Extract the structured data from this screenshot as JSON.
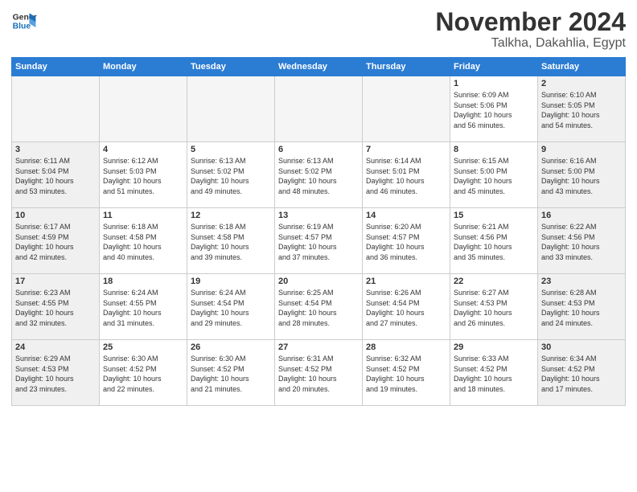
{
  "header": {
    "logo_line1": "General",
    "logo_line2": "Blue",
    "month": "November 2024",
    "location": "Talkha, Dakahlia, Egypt"
  },
  "weekdays": [
    "Sunday",
    "Monday",
    "Tuesday",
    "Wednesday",
    "Thursday",
    "Friday",
    "Saturday"
  ],
  "weeks": [
    [
      {
        "num": "",
        "info": "",
        "type": "empty"
      },
      {
        "num": "",
        "info": "",
        "type": "empty"
      },
      {
        "num": "",
        "info": "",
        "type": "empty"
      },
      {
        "num": "",
        "info": "",
        "type": "empty"
      },
      {
        "num": "",
        "info": "",
        "type": "empty"
      },
      {
        "num": "1",
        "info": "Sunrise: 6:09 AM\nSunset: 5:06 PM\nDaylight: 10 hours\nand 56 minutes.",
        "type": "weekday"
      },
      {
        "num": "2",
        "info": "Sunrise: 6:10 AM\nSunset: 5:05 PM\nDaylight: 10 hours\nand 54 minutes.",
        "type": "weekend"
      }
    ],
    [
      {
        "num": "3",
        "info": "Sunrise: 6:11 AM\nSunset: 5:04 PM\nDaylight: 10 hours\nand 53 minutes.",
        "type": "weekend"
      },
      {
        "num": "4",
        "info": "Sunrise: 6:12 AM\nSunset: 5:03 PM\nDaylight: 10 hours\nand 51 minutes.",
        "type": "weekday"
      },
      {
        "num": "5",
        "info": "Sunrise: 6:13 AM\nSunset: 5:02 PM\nDaylight: 10 hours\nand 49 minutes.",
        "type": "weekday"
      },
      {
        "num": "6",
        "info": "Sunrise: 6:13 AM\nSunset: 5:02 PM\nDaylight: 10 hours\nand 48 minutes.",
        "type": "weekday"
      },
      {
        "num": "7",
        "info": "Sunrise: 6:14 AM\nSunset: 5:01 PM\nDaylight: 10 hours\nand 46 minutes.",
        "type": "weekday"
      },
      {
        "num": "8",
        "info": "Sunrise: 6:15 AM\nSunset: 5:00 PM\nDaylight: 10 hours\nand 45 minutes.",
        "type": "weekday"
      },
      {
        "num": "9",
        "info": "Sunrise: 6:16 AM\nSunset: 5:00 PM\nDaylight: 10 hours\nand 43 minutes.",
        "type": "weekend"
      }
    ],
    [
      {
        "num": "10",
        "info": "Sunrise: 6:17 AM\nSunset: 4:59 PM\nDaylight: 10 hours\nand 42 minutes.",
        "type": "weekend"
      },
      {
        "num": "11",
        "info": "Sunrise: 6:18 AM\nSunset: 4:58 PM\nDaylight: 10 hours\nand 40 minutes.",
        "type": "weekday"
      },
      {
        "num": "12",
        "info": "Sunrise: 6:18 AM\nSunset: 4:58 PM\nDaylight: 10 hours\nand 39 minutes.",
        "type": "weekday"
      },
      {
        "num": "13",
        "info": "Sunrise: 6:19 AM\nSunset: 4:57 PM\nDaylight: 10 hours\nand 37 minutes.",
        "type": "weekday"
      },
      {
        "num": "14",
        "info": "Sunrise: 6:20 AM\nSunset: 4:57 PM\nDaylight: 10 hours\nand 36 minutes.",
        "type": "weekday"
      },
      {
        "num": "15",
        "info": "Sunrise: 6:21 AM\nSunset: 4:56 PM\nDaylight: 10 hours\nand 35 minutes.",
        "type": "weekday"
      },
      {
        "num": "16",
        "info": "Sunrise: 6:22 AM\nSunset: 4:56 PM\nDaylight: 10 hours\nand 33 minutes.",
        "type": "weekend"
      }
    ],
    [
      {
        "num": "17",
        "info": "Sunrise: 6:23 AM\nSunset: 4:55 PM\nDaylight: 10 hours\nand 32 minutes.",
        "type": "weekend"
      },
      {
        "num": "18",
        "info": "Sunrise: 6:24 AM\nSunset: 4:55 PM\nDaylight: 10 hours\nand 31 minutes.",
        "type": "weekday"
      },
      {
        "num": "19",
        "info": "Sunrise: 6:24 AM\nSunset: 4:54 PM\nDaylight: 10 hours\nand 29 minutes.",
        "type": "weekday"
      },
      {
        "num": "20",
        "info": "Sunrise: 6:25 AM\nSunset: 4:54 PM\nDaylight: 10 hours\nand 28 minutes.",
        "type": "weekday"
      },
      {
        "num": "21",
        "info": "Sunrise: 6:26 AM\nSunset: 4:54 PM\nDaylight: 10 hours\nand 27 minutes.",
        "type": "weekday"
      },
      {
        "num": "22",
        "info": "Sunrise: 6:27 AM\nSunset: 4:53 PM\nDaylight: 10 hours\nand 26 minutes.",
        "type": "weekday"
      },
      {
        "num": "23",
        "info": "Sunrise: 6:28 AM\nSunset: 4:53 PM\nDaylight: 10 hours\nand 24 minutes.",
        "type": "weekend"
      }
    ],
    [
      {
        "num": "24",
        "info": "Sunrise: 6:29 AM\nSunset: 4:53 PM\nDaylight: 10 hours\nand 23 minutes.",
        "type": "weekend"
      },
      {
        "num": "25",
        "info": "Sunrise: 6:30 AM\nSunset: 4:52 PM\nDaylight: 10 hours\nand 22 minutes.",
        "type": "weekday"
      },
      {
        "num": "26",
        "info": "Sunrise: 6:30 AM\nSunset: 4:52 PM\nDaylight: 10 hours\nand 21 minutes.",
        "type": "weekday"
      },
      {
        "num": "27",
        "info": "Sunrise: 6:31 AM\nSunset: 4:52 PM\nDaylight: 10 hours\nand 20 minutes.",
        "type": "weekday"
      },
      {
        "num": "28",
        "info": "Sunrise: 6:32 AM\nSunset: 4:52 PM\nDaylight: 10 hours\nand 19 minutes.",
        "type": "weekday"
      },
      {
        "num": "29",
        "info": "Sunrise: 6:33 AM\nSunset: 4:52 PM\nDaylight: 10 hours\nand 18 minutes.",
        "type": "weekday"
      },
      {
        "num": "30",
        "info": "Sunrise: 6:34 AM\nSunset: 4:52 PM\nDaylight: 10 hours\nand 17 minutes.",
        "type": "weekend"
      }
    ]
  ]
}
